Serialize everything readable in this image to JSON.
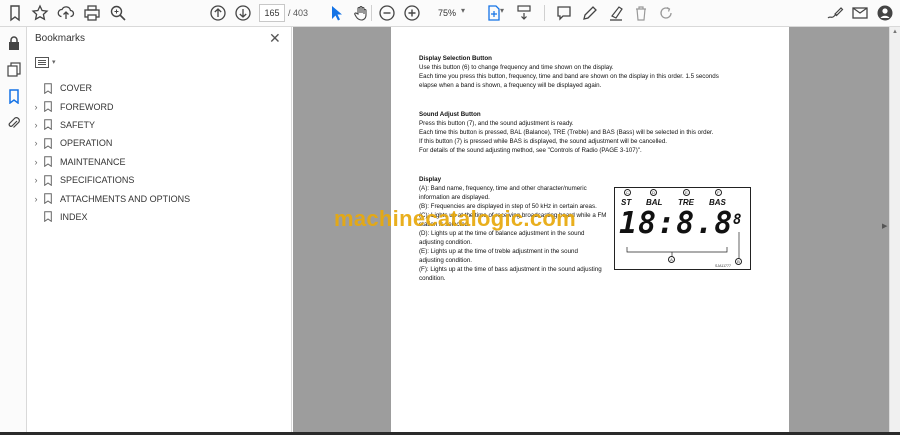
{
  "toolbar": {
    "page_current": "165",
    "page_separator": "/",
    "page_total": "403",
    "zoom": "75%"
  },
  "panel": {
    "title": "Bookmarks",
    "items": [
      {
        "label": "COVER",
        "expandable": false
      },
      {
        "label": "FOREWORD",
        "expandable": true
      },
      {
        "label": "SAFETY",
        "expandable": true
      },
      {
        "label": "OPERATION",
        "expandable": true
      },
      {
        "label": "MAINTENANCE",
        "expandable": true
      },
      {
        "label": "SPECIFICATIONS",
        "expandable": true
      },
      {
        "label": "ATTACHMENTS AND OPTIONS",
        "expandable": true
      },
      {
        "label": "INDEX",
        "expandable": false
      }
    ]
  },
  "document": {
    "s1_title": "Display Selection Button",
    "s1_l1": "Use this button (6) to change frequency and time shown on the display.",
    "s1_l2": "Each time you press this button, frequency, time and band are shown on the display in this order. 1.5 seconds",
    "s1_l3": "elapse when a band is shown, a frequency will be displayed again.",
    "s2_title": "Sound Adjust Button",
    "s2_l1": "Press this button (7), and the sound adjustment is ready.",
    "s2_l2": "Each time this button is pressed, BAL (Balance), TRE (Treble) and BAS (Bass) will be selected in this order.",
    "s2_l3": "If this button (7) is pressed while BAS is displayed, the sound adjustment will be cancelled.",
    "s2_l4": "For details of the sound adjusting method, see \"Controls of Radio (PAGE 3-107)\".",
    "s3_title": "Display",
    "s3_l1": "(A): Band name, frequency, time and other character/numeric",
    "s3_l2": "information are displayed.",
    "s3_l3": "(B): Frequencies are displayed in step of 50 kHz in certain areas.",
    "s3_l4": "(C): Lights up at the time of receiving broadcasting board while a FM",
    "s3_l5": "station is selected.",
    "s3_l6": "(D): Lights up at the time of balance adjustment in the sound",
    "s3_l7": "adjusting condition.",
    "s3_l8": "(E): Lights up at the time of treble adjustment in the sound",
    "s3_l9": "adjusting condition.",
    "s3_l10": "(F): Lights up at the time of bass adjustment in the sound adjusting",
    "s3_l11": "condition.",
    "watermark": "machinecatalogic.com"
  },
  "diagram": {
    "labels": [
      "ST",
      "BAL",
      "TRE",
      "BAS"
    ],
    "big_digits": "18:8.8",
    "small_digit": "8",
    "callouts": [
      "C",
      "D",
      "E",
      "F",
      "A",
      "B"
    ],
    "figure_id": "SJA11777"
  },
  "icons": {
    "toolbar": [
      "bookmark-icon",
      "star-icon",
      "upload-icon",
      "print-icon",
      "zoom-search-icon",
      "page-up-icon",
      "page-down-icon",
      "cursor-icon",
      "hand-icon",
      "zoom-out-icon",
      "zoom-in-icon",
      "page-fit-icon",
      "scroll-mode-icon",
      "comment-icon",
      "pen-icon",
      "highlight-icon",
      "delete-icon",
      "redo-icon",
      "sign-icon",
      "mail-icon",
      "account-icon"
    ],
    "rail": [
      "lock-icon",
      "pages-icon",
      "bookmarks-icon",
      "attachment-icon"
    ]
  },
  "colors": {
    "accent_blue": "#1473e6",
    "watermark": "#e8a90c",
    "doc_background": "#9d9d9d"
  }
}
